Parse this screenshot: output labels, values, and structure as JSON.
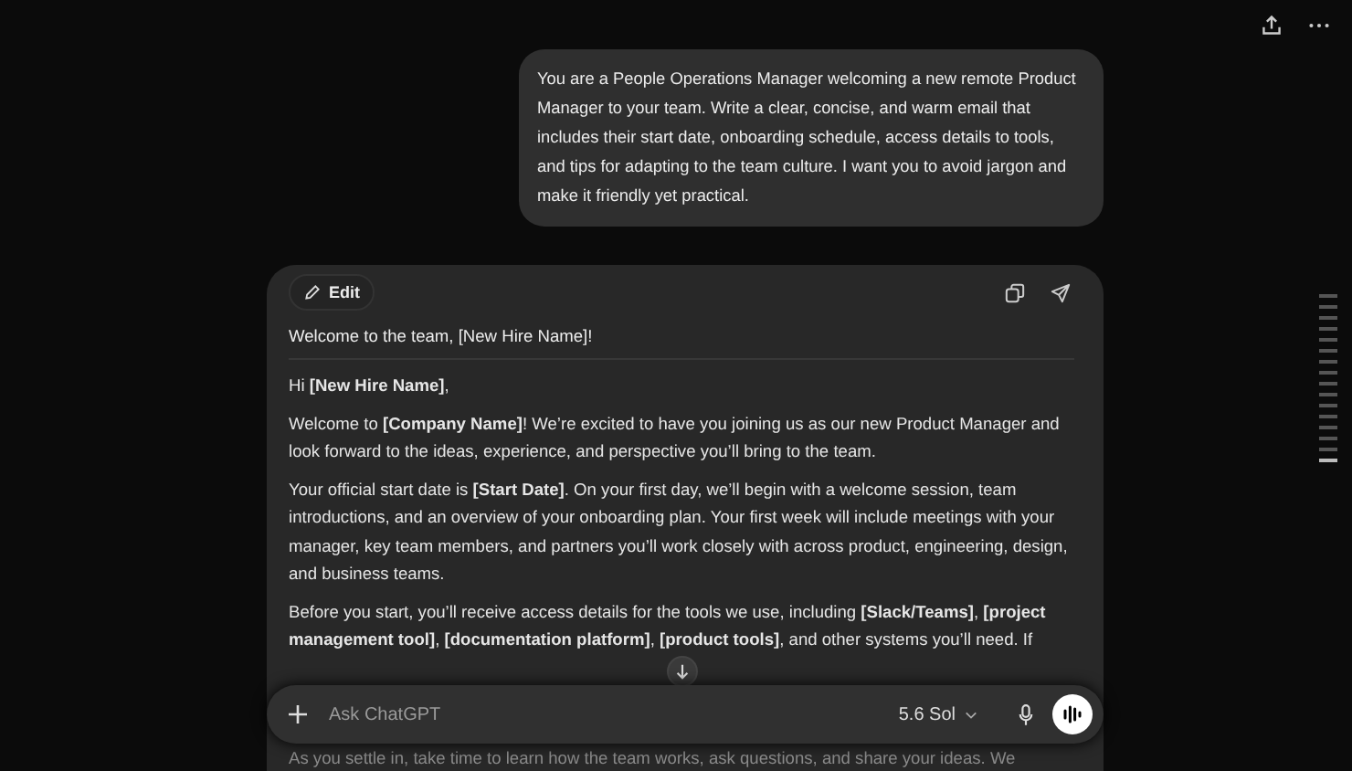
{
  "prompt": "You are a People Operations Manager welcoming a new remote Product Manager to your team. Write a clear, concise, and warm email that includes their start date, onboarding schedule, access details to tools, and tips for adapting to the team culture. I want you to avoid jargon and make it friendly yet practical.",
  "canvas": {
    "edit_label": "Edit",
    "heading": "Welcome to the team, [New Hire Name]!",
    "paragraphs": [
      "Hi **[New Hire Name]**,",
      "Welcome to **[Company Name]**! We’re excited to have you joining us as our new Product Manager and look forward to the ideas, experience, and perspective you’ll bring to the team.",
      "Your official start date is **[Start Date]**. On your first day, we’ll begin with a welcome session, team introductions, and an overview of your onboarding plan. Your first week will include meetings with your manager, key team members, and partners you’ll work closely with across product, engineering, design, and business teams.",
      "Before you start, you’ll receive access details for the tools we use, including **[Slack/Teams]**, **[project management tool]**, **[documentation platform]**, **[product tools]**, and other systems you’ll need. If"
    ],
    "below_composer": "As you settle in, take time to learn how the team works, ask questions, and share your ideas. We"
  },
  "composer": {
    "placeholder": "Ask ChatGPT",
    "model": "5.6 Sol"
  }
}
